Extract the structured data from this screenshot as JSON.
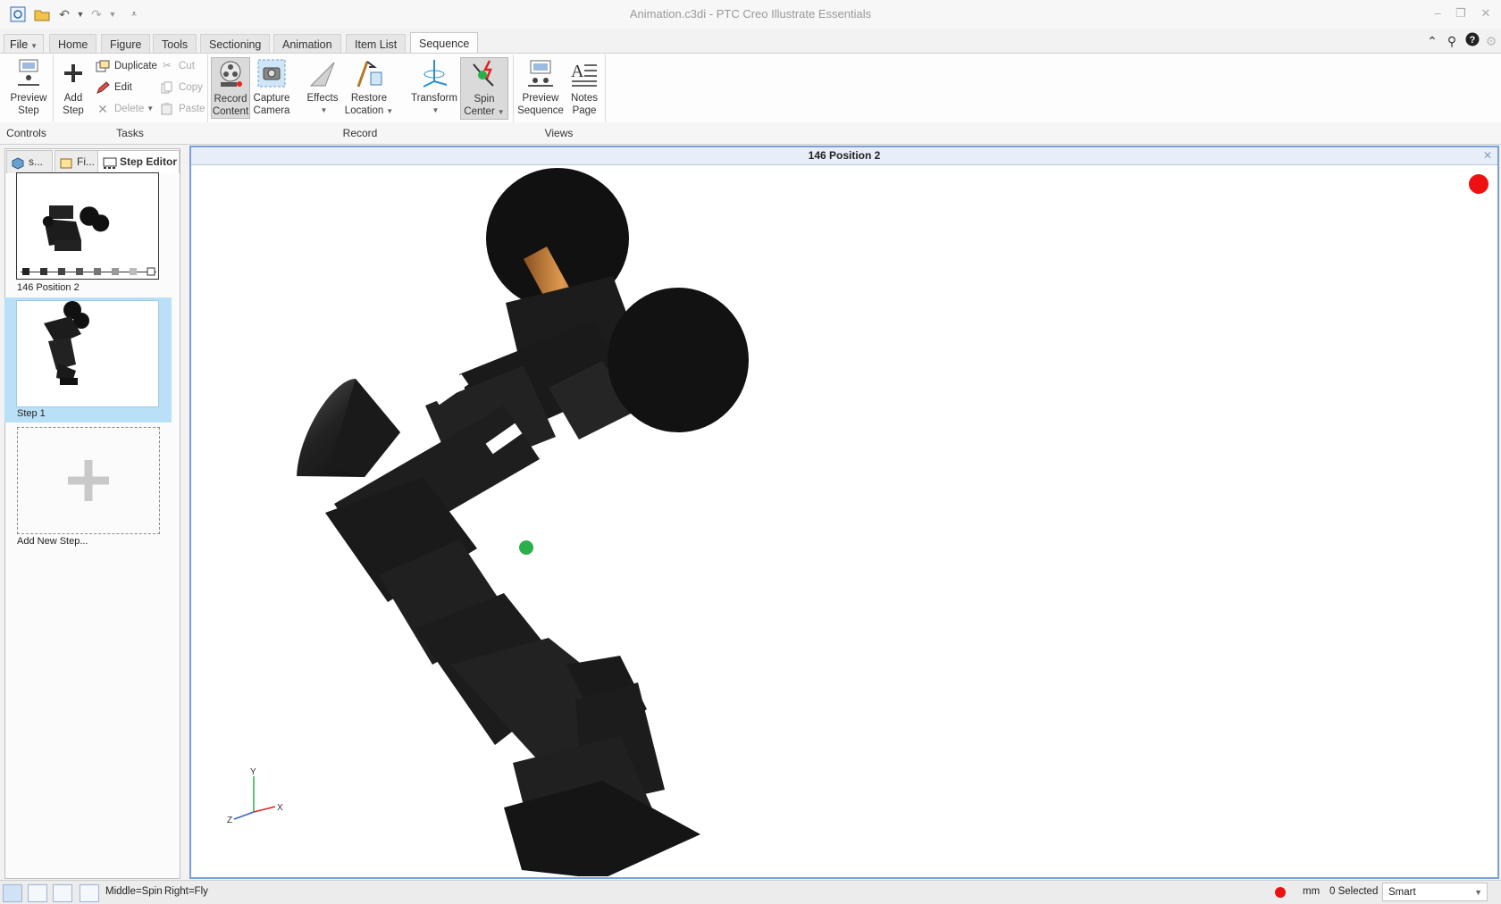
{
  "window": {
    "title": "Animation.c3di - PTC Creo Illustrate Essentials"
  },
  "file_menu": {
    "label": "File"
  },
  "tabs": [
    {
      "label": "Home"
    },
    {
      "label": "Figure"
    },
    {
      "label": "Tools"
    },
    {
      "label": "Sectioning"
    },
    {
      "label": "Animation"
    },
    {
      "label": "Item List"
    },
    {
      "label": "Sequence",
      "active": true
    }
  ],
  "ribbon": {
    "controls": {
      "preview_step": "Preview",
      "preview_step2": "Step"
    },
    "tasks": {
      "add_step": "Add",
      "add_step2": "Step",
      "duplicate": "Duplicate",
      "edit": "Edit",
      "delete": "Delete",
      "cut": "Cut",
      "copy": "Copy",
      "paste": "Paste"
    },
    "record": {
      "record_content": "Record",
      "record_content2": "Content",
      "capture_camera": "Capture",
      "capture_camera2": "Camera",
      "effects": "Effects",
      "restore_location": "Restore",
      "restore_location2": "Location",
      "transform": "Transform",
      "spin_center": "Spin",
      "spin_center2": "Center"
    },
    "views": {
      "preview_sequence": "Preview",
      "preview_sequence2": "Sequence",
      "notes_page": "Notes",
      "notes_page2": "Page"
    },
    "groups": {
      "controls": "Controls",
      "tasks": "Tasks",
      "record": "Record",
      "views": "Views"
    }
  },
  "left_panel": {
    "tabs": [
      {
        "label": "s..."
      },
      {
        "label": "Fi..."
      },
      {
        "label": "Step Editor",
        "active": true
      }
    ],
    "steps": [
      {
        "label": "146 Position 2"
      },
      {
        "label": "Step 1",
        "selected": true
      }
    ],
    "add_step": "Add New Step..."
  },
  "viewport": {
    "title": "146 Position 2",
    "axes": {
      "x": "X",
      "y": "Y",
      "z": "Z"
    }
  },
  "status_bar": {
    "hint_middle": "Middle=Spin",
    "hint_right": "Right=Fly",
    "units": "mm",
    "selected": "0 Selected",
    "select_mode": "Smart"
  },
  "colors": {
    "accent": "#7a9fd9",
    "selected_step": "#b9e0f7",
    "record": "#ee1111",
    "robot": "#1c1c1c",
    "shaft": "#c8813f"
  }
}
